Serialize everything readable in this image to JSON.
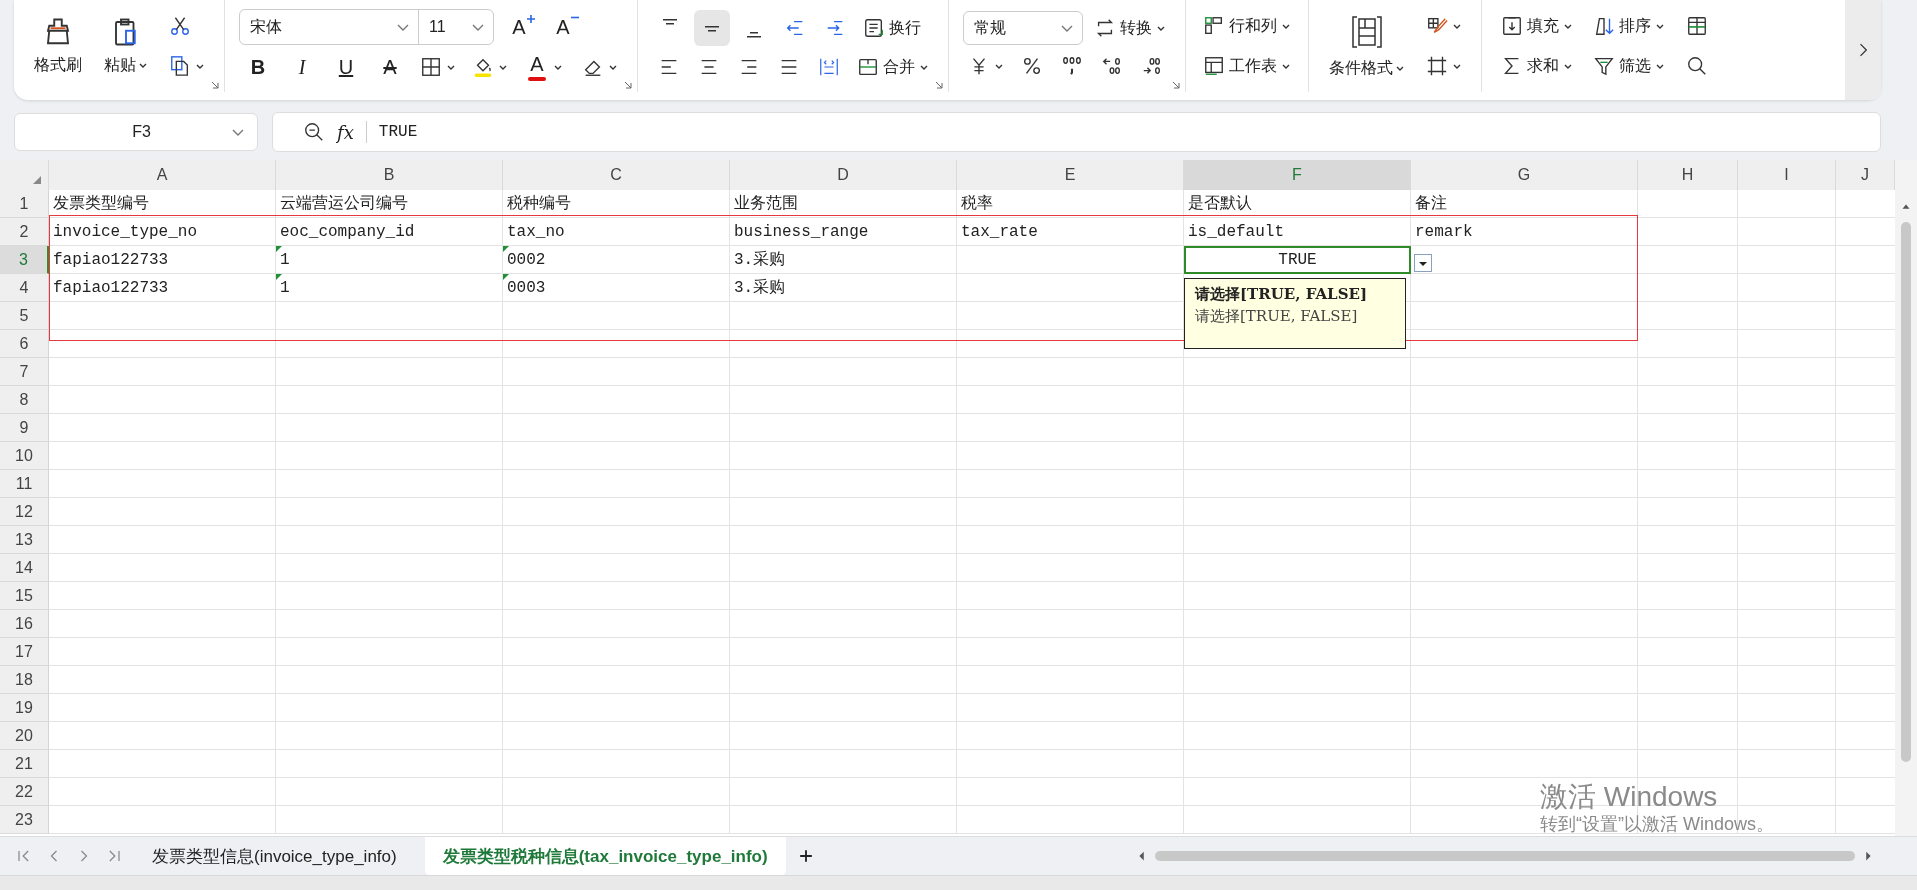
{
  "ribbon": {
    "clipboard": {
      "format_painter": "格式刷",
      "paste": "粘贴"
    },
    "font": {
      "font_name": "宋体",
      "font_size": "11",
      "grow": "A",
      "shrink": "A",
      "bold": "B",
      "italic": "I",
      "underline": "U",
      "strike": "A",
      "font_color": "A"
    },
    "alignment": {
      "vertical_buttons": [
        {
          "selected": false
        },
        {
          "selected": true
        },
        {
          "selected": false
        }
      ],
      "wrap": "换行",
      "merge": "合并"
    },
    "number": {
      "format": "常规",
      "convert": "转换"
    },
    "cells": {
      "rows_columns": "行和列",
      "worksheet": "工作表"
    },
    "styles": {
      "conditional_format": "条件格式"
    },
    "editing": {
      "fill": "填充",
      "sort": "排序",
      "sum": "求和",
      "filter": "筛选"
    }
  },
  "formula_bar": {
    "name_box": "F3",
    "fx": "fx",
    "value": "TRUE"
  },
  "columns": [
    {
      "letter": "A",
      "selected": false
    },
    {
      "letter": "B",
      "selected": false
    },
    {
      "letter": "C",
      "selected": false
    },
    {
      "letter": "D",
      "selected": false
    },
    {
      "letter": "E",
      "selected": false
    },
    {
      "letter": "F",
      "selected": true
    },
    {
      "letter": "G",
      "selected": false
    },
    {
      "letter": "H",
      "selected": false
    },
    {
      "letter": "I",
      "selected": false
    },
    {
      "letter": "J",
      "selected": false
    }
  ],
  "rows": [
    {
      "number": "1",
      "selected": false,
      "cells": [
        {
          "text": "发票类型编号",
          "marker": false,
          "selected": false
        },
        {
          "text": "云端营运公司编号",
          "marker": false,
          "selected": false
        },
        {
          "text": "税种编号",
          "marker": false,
          "selected": false
        },
        {
          "text": "业务范围",
          "marker": false,
          "selected": false
        },
        {
          "text": "税率",
          "marker": false,
          "selected": false
        },
        {
          "text": "是否默认",
          "marker": false,
          "selected": false
        },
        {
          "text": "备注",
          "marker": false,
          "selected": false
        }
      ]
    },
    {
      "number": "2",
      "selected": false,
      "cells": [
        {
          "text": "invoice_type_no",
          "marker": false,
          "selected": false
        },
        {
          "text": "eoc_company_id",
          "marker": false,
          "selected": false
        },
        {
          "text": "tax_no",
          "marker": false,
          "selected": false
        },
        {
          "text": "business_range",
          "marker": false,
          "selected": false
        },
        {
          "text": "tax_rate",
          "marker": false,
          "selected": false
        },
        {
          "text": "is_default",
          "marker": false,
          "selected": false
        },
        {
          "text": "remark",
          "marker": false,
          "selected": false
        }
      ]
    },
    {
      "number": "3",
      "selected": true,
      "cells": [
        {
          "text": "fapiao122733",
          "marker": false,
          "selected": false
        },
        {
          "text": "1",
          "marker": true,
          "selected": false
        },
        {
          "text": "0002",
          "marker": true,
          "selected": false
        },
        {
          "text": "3.采购",
          "marker": false,
          "selected": false
        },
        {
          "marker": false,
          "selected": false
        },
        {
          "text": "TRUE",
          "marker": false,
          "selected": true,
          "centered": true
        }
      ]
    },
    {
      "number": "4",
      "selected": false,
      "cells": [
        {
          "text": "fapiao122733",
          "marker": false,
          "selected": false
        },
        {
          "text": "1",
          "marker": true,
          "selected": false
        },
        {
          "text": "0003",
          "marker": true,
          "selected": false
        },
        {
          "text": "3.采购",
          "marker": false,
          "selected": false
        }
      ]
    },
    {
      "number": "5",
      "selected": false
    },
    {
      "number": "6",
      "selected": false
    },
    {
      "number": "7",
      "selected": false
    },
    {
      "number": "8",
      "selected": false
    },
    {
      "number": "9",
      "selected": false
    },
    {
      "number": "10",
      "selected": false
    },
    {
      "number": "11",
      "selected": false
    },
    {
      "number": "12",
      "selected": false
    },
    {
      "number": "13",
      "selected": false
    },
    {
      "number": "14",
      "selected": false
    },
    {
      "number": "15",
      "selected": false
    },
    {
      "number": "16",
      "selected": false
    },
    {
      "number": "17",
      "selected": false
    },
    {
      "number": "18",
      "selected": false
    },
    {
      "number": "19",
      "selected": false
    },
    {
      "number": "20",
      "selected": false
    },
    {
      "number": "21",
      "selected": false
    },
    {
      "number": "22",
      "selected": false
    },
    {
      "number": "23",
      "selected": false
    }
  ],
  "validation_popup": {
    "title": "请选择[TRUE, FALSE]",
    "message": "请选择[TRUE, FALSE]"
  },
  "sheet_tabs": [
    {
      "label": "发票类型信息(invoice_type_info)",
      "selected": false
    },
    {
      "label": "发票类型税种信息(tax_invoice_type_info)",
      "selected": true
    }
  ],
  "activation_notice": {
    "title": "激活 Windows",
    "message": "转到“设置”以激活 Windows。"
  }
}
